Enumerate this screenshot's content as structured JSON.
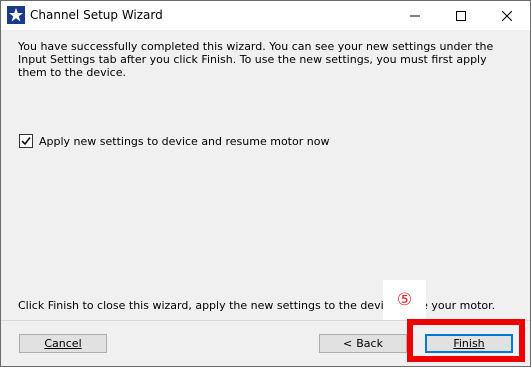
{
  "window": {
    "title": "Channel Setup Wizard"
  },
  "intro_text": "You have successfully completed this wizard.  You can see your new settings under the Input Settings tab after you click Finish.  To use the new settings, you must first apply them to the device.",
  "checkbox": {
    "label": "Apply new settings to device and resume motor now",
    "checked": true
  },
  "footer_text": "Click Finish to close this wizard, apply the new settings to the device,        ume your motor.",
  "step_marker": "⑤",
  "buttons": {
    "cancel": "Cancel",
    "back": "Back",
    "finish": "Finish"
  },
  "colors": {
    "highlight": "#ee0000",
    "marker": "#e8232a",
    "focus": "#0078d7"
  }
}
